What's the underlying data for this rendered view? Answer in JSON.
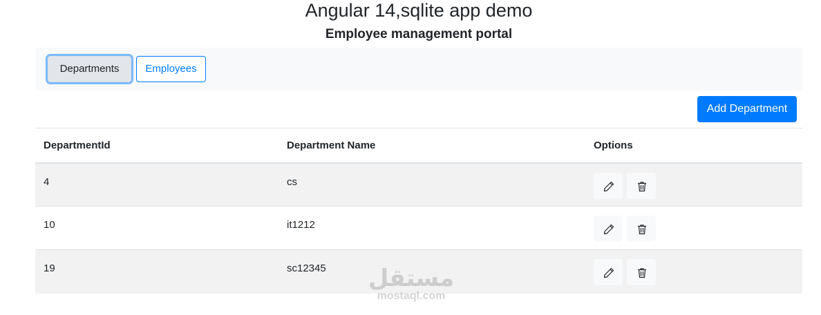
{
  "header": {
    "title": "Angular 14,sqlite app demo",
    "subtitle": "Employee management portal"
  },
  "nav": {
    "departments_label": "Departments",
    "employees_label": "Employees"
  },
  "toolbar": {
    "add_label": "Add Department"
  },
  "table": {
    "columns": [
      "DepartmentId",
      "Department Name",
      "Options"
    ],
    "rows": [
      {
        "id": "4",
        "name": "cs"
      },
      {
        "id": "10",
        "name": "it1212"
      },
      {
        "id": "19",
        "name": "sc12345"
      }
    ],
    "row_icons": [
      "pencil-icon",
      "trash-icon"
    ]
  },
  "watermark": {
    "arabic": "مستقل",
    "latin": "mostaql.com"
  },
  "colors": {
    "primary": "#007bff",
    "navbar_bg": "#f8f9fa",
    "stripe": "#f2f2f2"
  }
}
